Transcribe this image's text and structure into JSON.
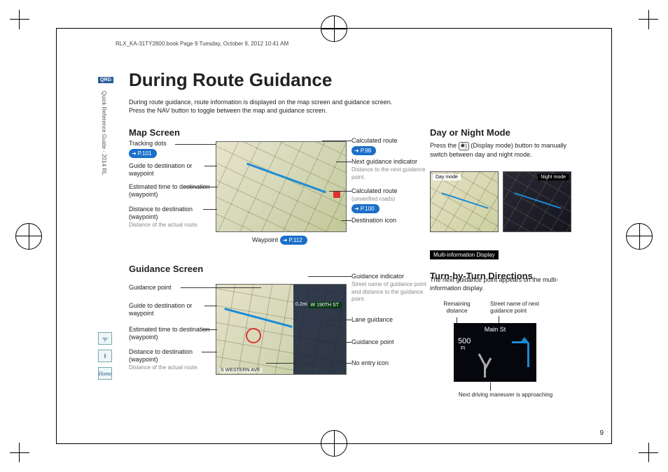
{
  "runhead": "RLX_KA-31TY2800.book  Page 9  Tuesday, October 9, 2012  10:41 AM",
  "qrg": "QRG",
  "sidebar_text": "Quick Reference Guide - 2014 RL",
  "title": "During Route Guidance",
  "intro1": "During route guidance, route information is displayed on the map screen and guidance screen.",
  "intro2": "Press the NAV button to toggle between the map and guidance screen.",
  "h_map": "Map Screen",
  "map_left": {
    "tracking": "Tracking dots",
    "tracking_p": "P.101",
    "guide": "Guide to destination or waypoint",
    "eta": "Estimated time to destination (waypoint)",
    "dist": "Distance to destination (waypoint)",
    "dist_sub": "Distance of the actual route."
  },
  "map_right": {
    "calc": "Calculated route",
    "calc_p": "P.98",
    "next": "Next guidance indicator",
    "next_sub": "Distance to the next guidance point.",
    "unver": "Calculated route",
    "unver_sub": "(unverified roads)",
    "unver_p": "P.100",
    "dest": "Destination icon"
  },
  "waypoint": "Waypoint",
  "waypoint_p": "P.112",
  "h_guide": "Guidance Screen",
  "guide_left": {
    "gp": "Guidance point",
    "guide": "Guide to destination or waypoint",
    "eta": "Estimated time to destination (waypoint)",
    "dist": "Distance to destination (waypoint)",
    "dist_sub": "Distance of the actual route."
  },
  "guide_right": {
    "gi": "Guidance indicator",
    "gi_sub": "Street name of guidance point and distance to the guidance point.",
    "lane": "Lane guidance",
    "gp": "Guidance point",
    "noentry": "No entry icon"
  },
  "map2_street": "W 190TH ST",
  "map2_dist": "0.2mi",
  "map2_bottom": "S WESTERN AVE",
  "h_day": "Day or Night Mode",
  "day_txt1": "Press the ",
  "day_btn": "✱)",
  "day_txt2": " (Display mode) button to manually switch between day and night mode.",
  "day_label": "Day mode",
  "night_label": "Night mode",
  "mid": "Multi-information Display",
  "h_turn": "Turn-by-Turn Directions",
  "turn_txt": "The next guidance point appears on the multi-information display.",
  "mfd": {
    "street": "Main St",
    "num": "500",
    "unit": "Ft"
  },
  "annot": {
    "rem": "Remaining distance",
    "stnext": "Street name of next guidance point",
    "next": "Next driving maneuver is approaching"
  },
  "page": "9",
  "home": "Home"
}
